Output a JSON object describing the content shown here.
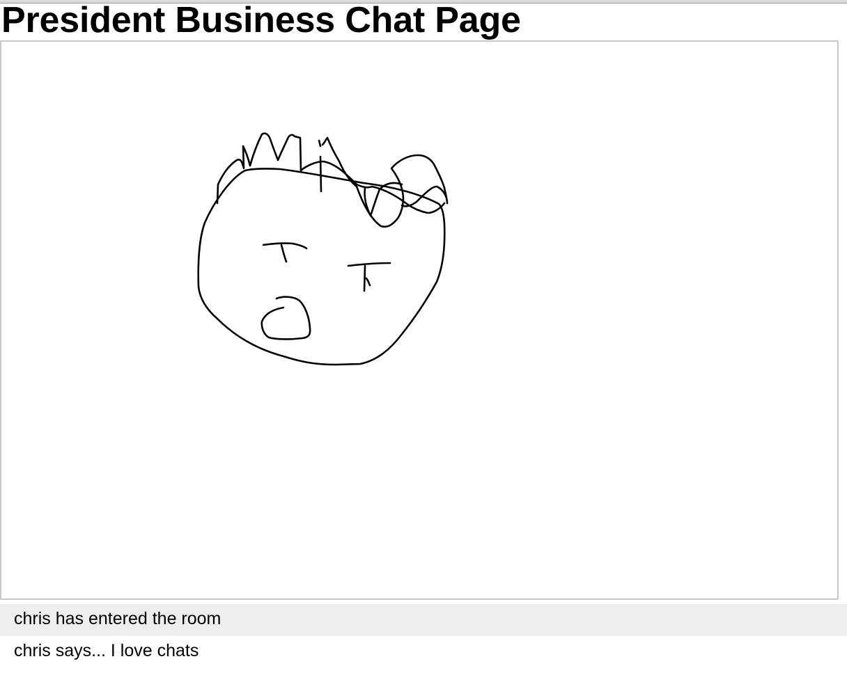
{
  "page": {
    "title": "President Business Chat Page"
  },
  "drawing": {
    "stroke_color": "#000000",
    "background_color": "#ffffff"
  },
  "chat": {
    "messages": [
      {
        "text": "chris has entered the room"
      },
      {
        "text": "chris says... I love chats"
      }
    ]
  }
}
